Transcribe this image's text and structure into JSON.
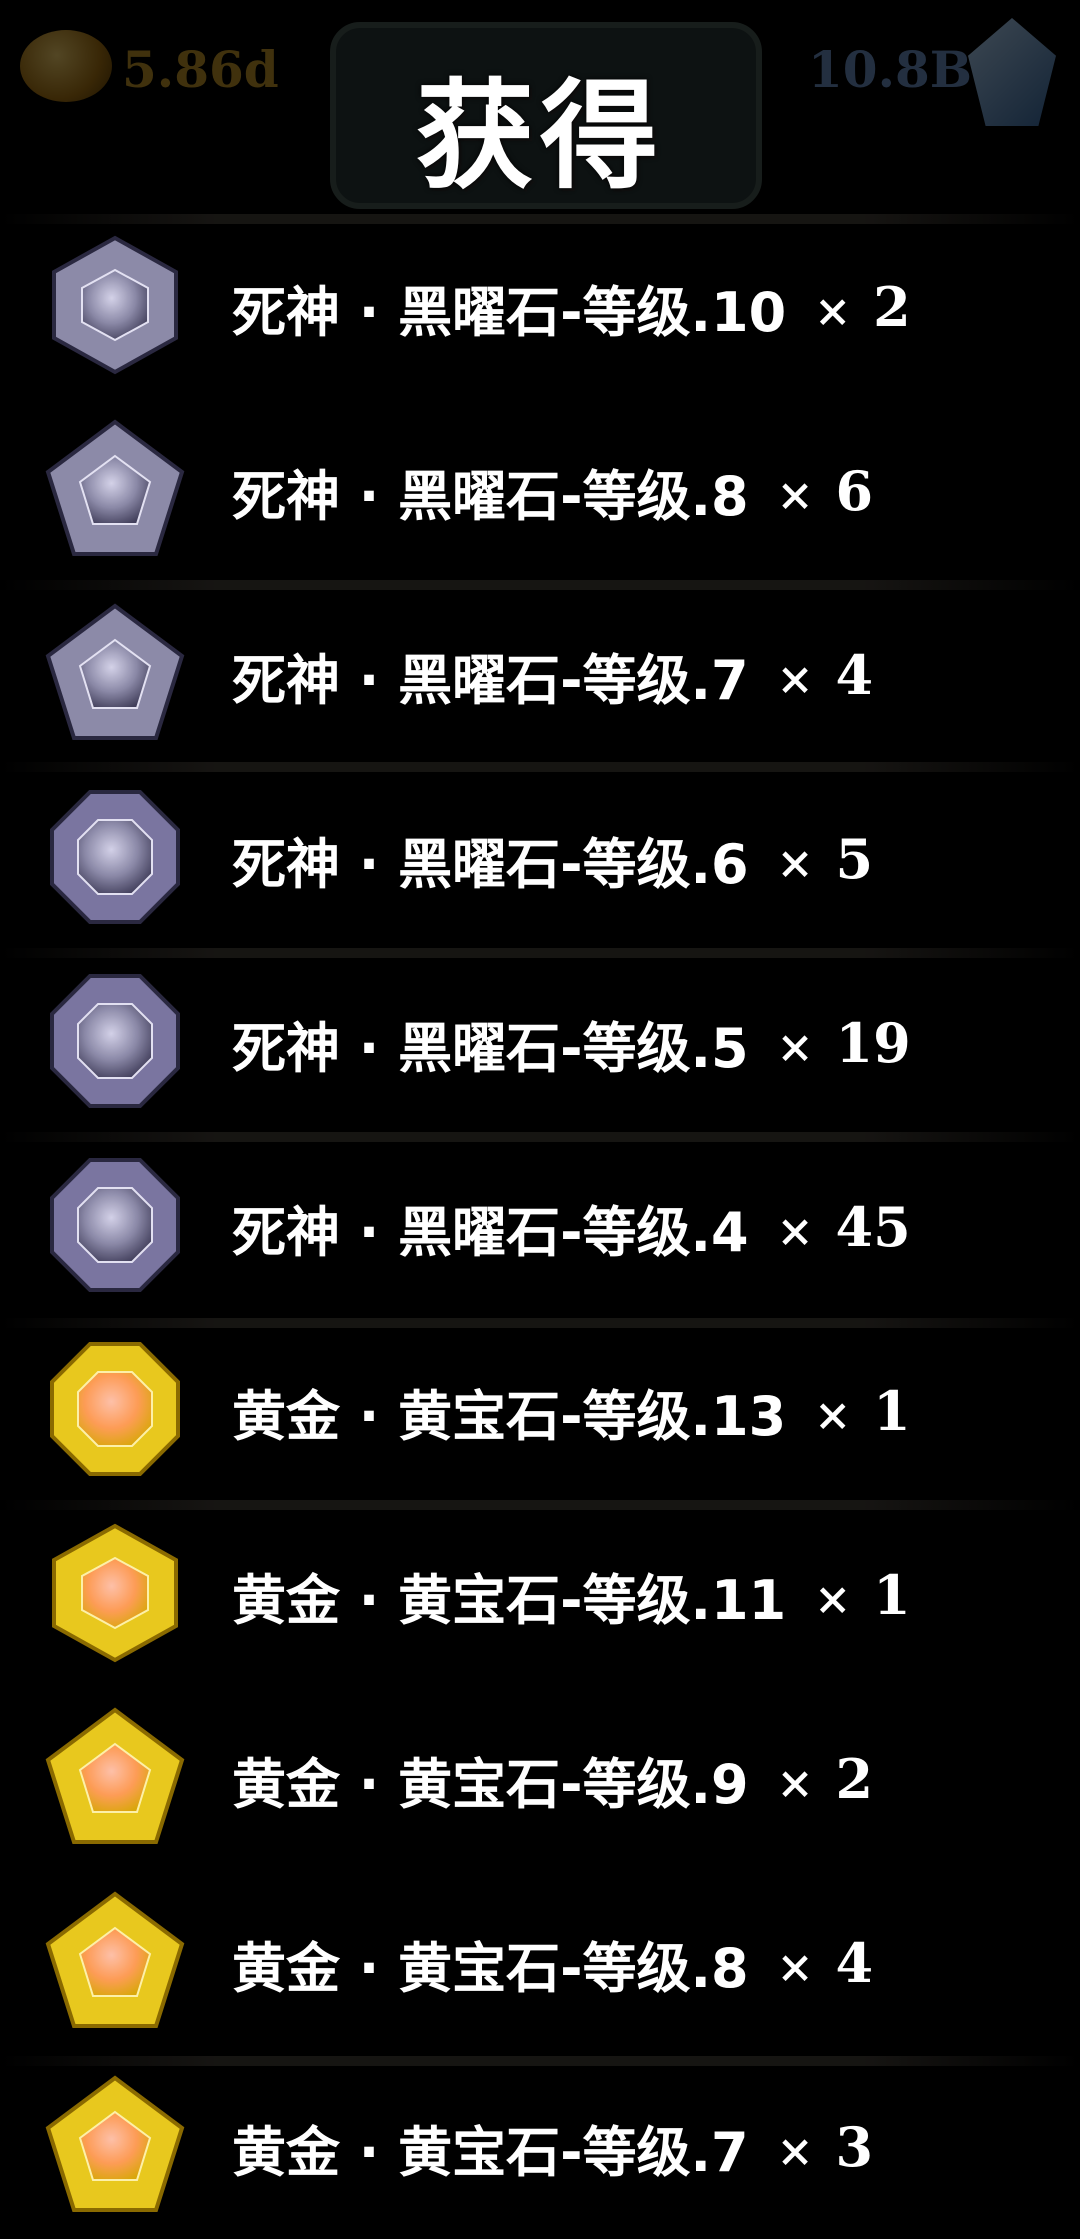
{
  "hud": {
    "gold_amount": "5.86d",
    "gem_amount": "10.8B",
    "coin_icon": "gold-coin-icon",
    "gem_icon": "blue-crystal-icon"
  },
  "title": "获得",
  "items": [
    {
      "name": "死神 · 黑曜石-等级.10",
      "mult": "×",
      "qty": "2",
      "icon": "hexagon-obsidian-icon",
      "color": "#8c8aa8"
    },
    {
      "name": "死神 · 黑曜石-等级.8",
      "mult": "×",
      "qty": "6",
      "icon": "pentagon-obsidian-icon",
      "color": "#8c8aa8"
    },
    {
      "name": "死神 · 黑曜石-等级.7",
      "mult": "×",
      "qty": "4",
      "icon": "pentagon-obsidian-icon",
      "color": "#8c8aa8"
    },
    {
      "name": "死神 · 黑曜石-等级.6",
      "mult": "×",
      "qty": "5",
      "icon": "octagon-obsidian-icon",
      "color": "#7a75a0"
    },
    {
      "name": "死神 · 黑曜石-等级.5",
      "mult": "×",
      "qty": "19",
      "icon": "octagon-obsidian-icon",
      "color": "#7a75a0"
    },
    {
      "name": "死神 · 黑曜石-等级.4",
      "mult": "×",
      "qty": "45",
      "icon": "octagon-obsidian-icon",
      "color": "#7a75a0"
    },
    {
      "name": "黄金 · 黄宝石-等级.13",
      "mult": "×",
      "qty": "1",
      "icon": "octagon-topaz-icon",
      "color": "#e8c81e"
    },
    {
      "name": "黄金 · 黄宝石-等级.11",
      "mult": "×",
      "qty": "1",
      "icon": "hexagon-topaz-icon",
      "color": "#e8c81e"
    },
    {
      "name": "黄金 · 黄宝石-等级.9",
      "mult": "×",
      "qty": "2",
      "icon": "pentagon-topaz-icon",
      "color": "#e8c81e"
    },
    {
      "name": "黄金 · 黄宝石-等级.8",
      "mult": "×",
      "qty": "4",
      "icon": "pentagon-topaz-icon",
      "color": "#e8c81e"
    },
    {
      "name": "黄金 · 黄宝石-等级.7",
      "mult": "×",
      "qty": "3",
      "icon": "pentagon-topaz-icon",
      "color": "#e8c81e"
    }
  ]
}
